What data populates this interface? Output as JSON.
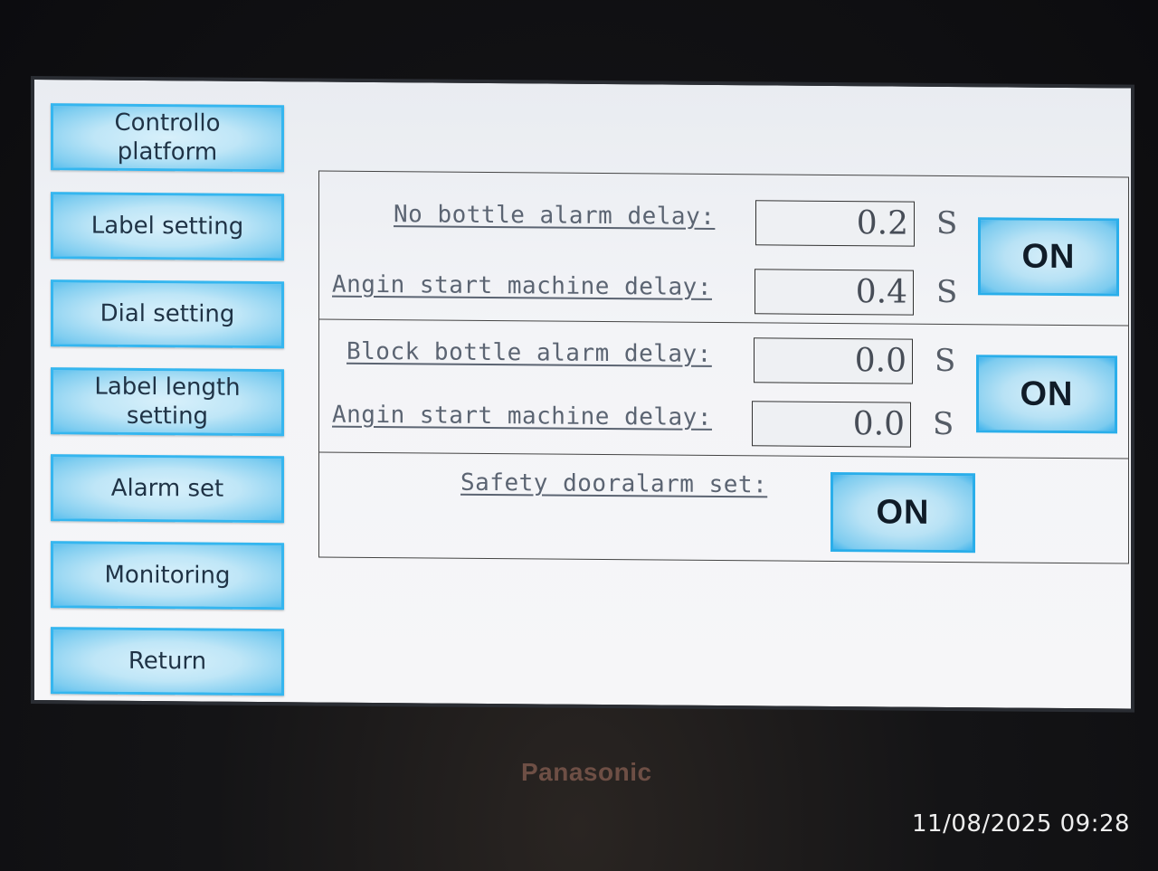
{
  "sidebar": {
    "items": [
      {
        "label": "Controllo\nplatform"
      },
      {
        "label": "Label setting"
      },
      {
        "label": "Dial setting"
      },
      {
        "label": "Label length\nsetting"
      },
      {
        "label": "Alarm set"
      },
      {
        "label": "Monitoring"
      },
      {
        "label": "Return"
      }
    ]
  },
  "alarms": {
    "group1": {
      "row1": {
        "label": "No bottle alarm delay:",
        "value": "0.2",
        "unit": "S"
      },
      "row2": {
        "label": "Angin start machine delay:",
        "value": "0.4",
        "unit": "S"
      },
      "toggle": "ON"
    },
    "group2": {
      "row1": {
        "label": "Block bottle alarm delay:",
        "value": "0.0",
        "unit": "S"
      },
      "row2": {
        "label": "Angin start machine delay:",
        "value": "0.0",
        "unit": "S"
      },
      "toggle": "ON"
    },
    "group3": {
      "label": "Safety dooralarm set:",
      "toggle": "ON"
    }
  },
  "device": {
    "brand": "Panasonic"
  },
  "photo_timestamp": "11/08/2025 09:28",
  "colors": {
    "button_border": "#35b6ef",
    "button_fill": "#bfe6f7",
    "screen_bg": "#f3f4f7"
  }
}
